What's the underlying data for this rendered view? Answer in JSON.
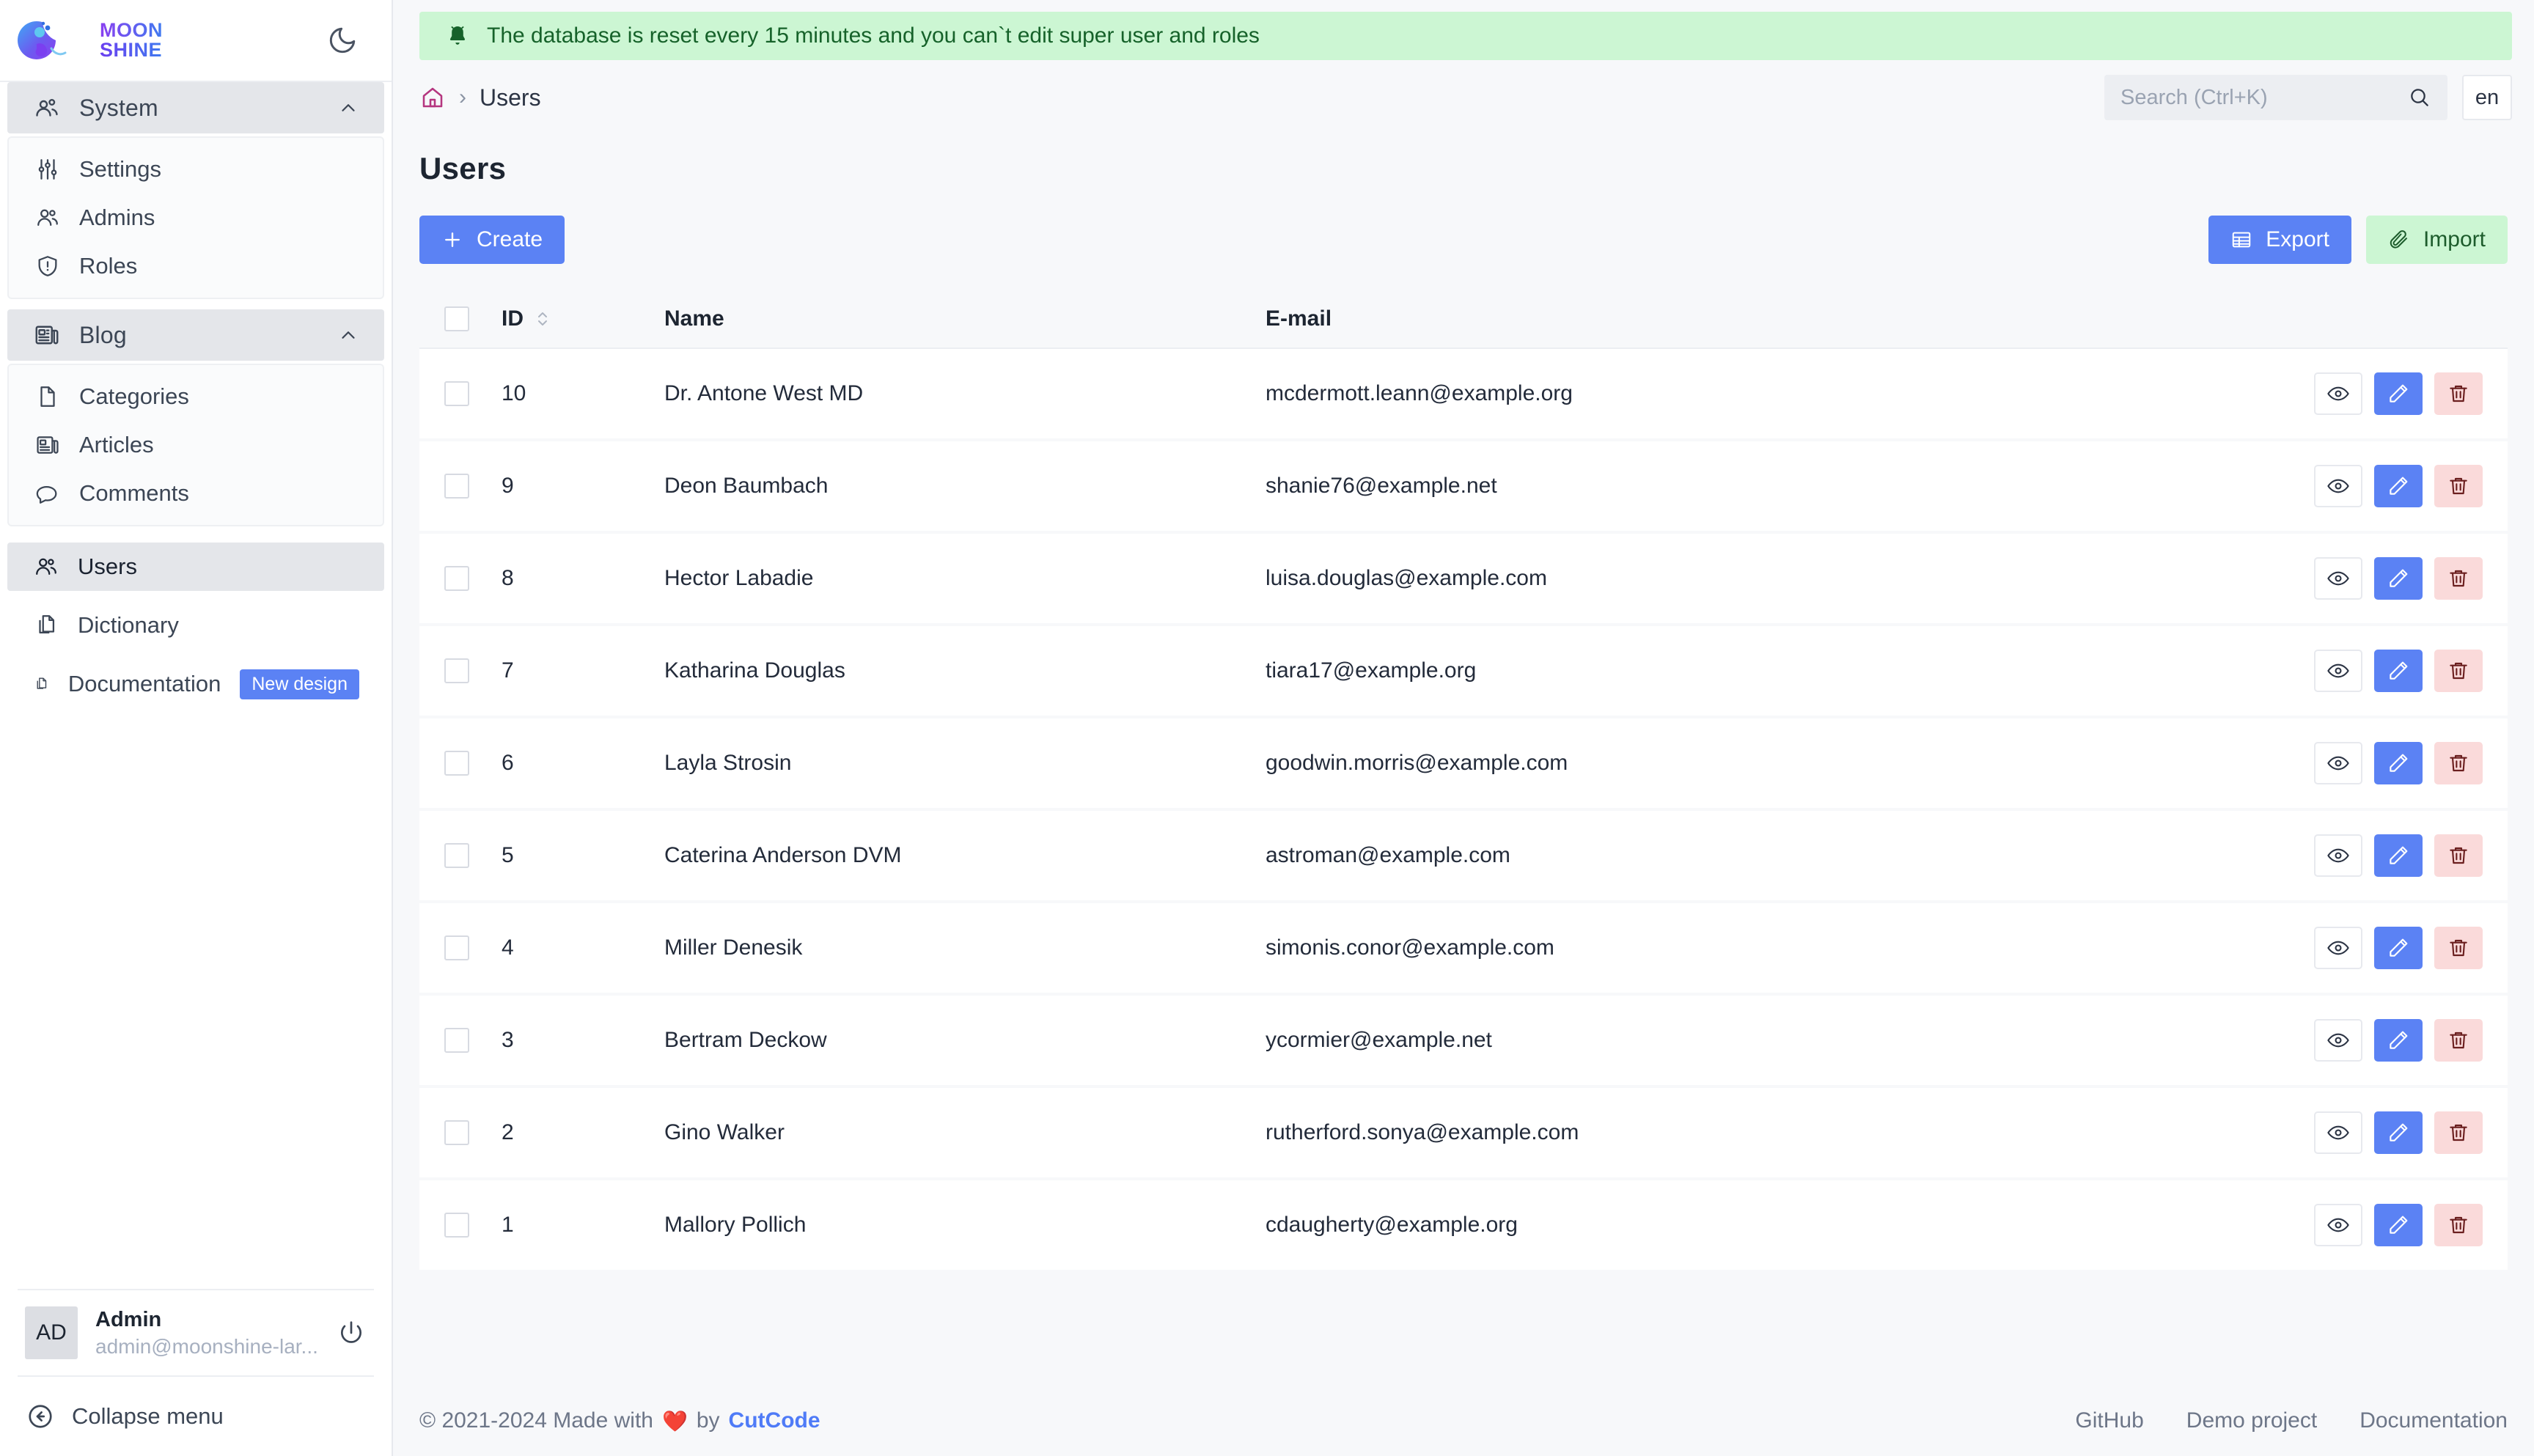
{
  "app": {
    "logo_top": "MOON",
    "logo_bottom": "SHINE",
    "theme_toggle_icon": "moon-icon"
  },
  "alert": {
    "icon": "bell-icon",
    "message": "The database is reset every 15 minutes and you can`t edit super user and roles"
  },
  "breadcrumb": {
    "home_icon": "home-icon",
    "separator": "›",
    "current": "Users"
  },
  "search": {
    "placeholder": "Search (Ctrl+K)",
    "value": "",
    "icon": "search-icon"
  },
  "language": {
    "current": "en"
  },
  "sidebar": {
    "groups": [
      {
        "label": "System",
        "icon": "users-group-icon",
        "chevron": "chevron-up-icon",
        "expanded": true,
        "items": [
          {
            "label": "Settings",
            "icon": "sliders-icon"
          },
          {
            "label": "Admins",
            "icon": "users-icon"
          },
          {
            "label": "Roles",
            "icon": "shield-alert-icon"
          }
        ]
      },
      {
        "label": "Blog",
        "icon": "news-icon",
        "chevron": "chevron-up-icon",
        "expanded": true,
        "items": [
          {
            "label": "Categories",
            "icon": "document-icon"
          },
          {
            "label": "Articles",
            "icon": "news-icon"
          },
          {
            "label": "Comments",
            "icon": "chat-bubble-icon"
          }
        ]
      }
    ],
    "links": [
      {
        "label": "Users",
        "icon": "users-icon",
        "active": true,
        "badge": ""
      },
      {
        "label": "Dictionary",
        "icon": "documents-icon",
        "active": false,
        "badge": ""
      },
      {
        "label": "Documentation",
        "icon": "documents-icon",
        "active": false,
        "badge": "New design"
      }
    ],
    "user": {
      "initials": "AD",
      "name": "Admin",
      "email": "admin@moonshine-lar...",
      "logout_icon": "power-icon"
    },
    "collapse": {
      "label": "Collapse menu",
      "icon": "arrow-left-circle-icon"
    }
  },
  "page": {
    "title": "Users",
    "create_button": "Create",
    "create_icon": "plus-icon",
    "export_button": "Export",
    "export_icon": "table-icon",
    "import_button": "Import",
    "import_icon": "paperclip-icon"
  },
  "table": {
    "select_all_checkbox": false,
    "columns": [
      {
        "key": "id",
        "label": "ID",
        "sortable": true,
        "sort_icon": "sort-icon"
      },
      {
        "key": "name",
        "label": "Name",
        "sortable": false
      },
      {
        "key": "email",
        "label": "E-mail",
        "sortable": false
      }
    ],
    "row_actions": [
      {
        "name": "view",
        "icon": "eye-icon"
      },
      {
        "name": "edit",
        "icon": "pencil-icon"
      },
      {
        "name": "delete",
        "icon": "trash-icon"
      }
    ],
    "rows": [
      {
        "id": "10",
        "name": "Dr. Antone West MD",
        "email": "mcdermott.leann@example.org"
      },
      {
        "id": "9",
        "name": "Deon Baumbach",
        "email": "shanie76@example.net"
      },
      {
        "id": "8",
        "name": "Hector Labadie",
        "email": "luisa.douglas@example.com"
      },
      {
        "id": "7",
        "name": "Katharina Douglas",
        "email": "tiara17@example.org"
      },
      {
        "id": "6",
        "name": "Layla Strosin",
        "email": "goodwin.morris@example.com"
      },
      {
        "id": "5",
        "name": "Caterina Anderson DVM",
        "email": "astroman@example.com"
      },
      {
        "id": "4",
        "name": "Miller Denesik",
        "email": "simonis.conor@example.com"
      },
      {
        "id": "3",
        "name": "Bertram Deckow",
        "email": "ycormier@example.net"
      },
      {
        "id": "2",
        "name": "Gino Walker",
        "email": "rutherford.sonya@example.com"
      },
      {
        "id": "1",
        "name": "Mallory Pollich",
        "email": "cdaugherty@example.org"
      }
    ]
  },
  "footer": {
    "copyright_prefix": "© 2021-2024 Made with",
    "heart": "❤️",
    "copyright_by": "by",
    "brand": "CutCode",
    "links": [
      "GitHub",
      "Demo project",
      "Documentation"
    ]
  },
  "colors": {
    "accent_blue": "#5b82f4",
    "success_green": "#ccf6d3",
    "success_text": "#16622a",
    "danger_bg": "#fadada",
    "home_icon": "#b5367f",
    "page_bg": "#f7f8fa"
  }
}
